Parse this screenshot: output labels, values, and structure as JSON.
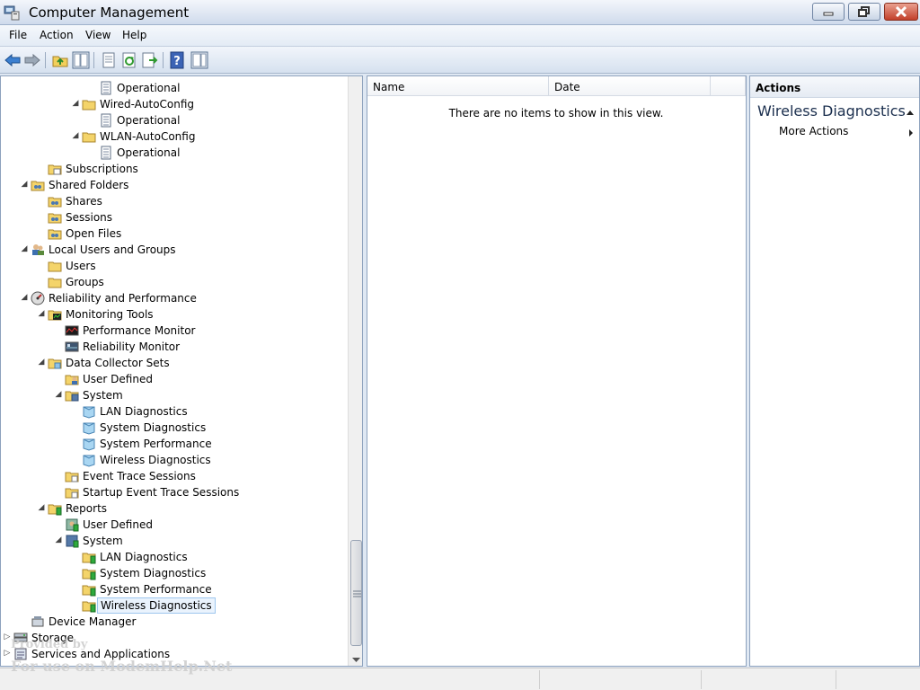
{
  "window": {
    "title": "Computer Management"
  },
  "menu": [
    "File",
    "Action",
    "View",
    "Help"
  ],
  "tree": [
    {
      "label": "Operational",
      "indent": 5,
      "icon": "log",
      "exp": ""
    },
    {
      "label": "Wired-AutoConfig",
      "indent": 4,
      "icon": "folder",
      "exp": "open"
    },
    {
      "label": "Operational",
      "indent": 5,
      "icon": "log",
      "exp": ""
    },
    {
      "label": "WLAN-AutoConfig",
      "indent": 4,
      "icon": "folder",
      "exp": "open"
    },
    {
      "label": "Operational",
      "indent": 5,
      "icon": "log",
      "exp": ""
    },
    {
      "label": "Subscriptions",
      "indent": 2,
      "icon": "subscriptions",
      "exp": ""
    },
    {
      "label": "Shared Folders",
      "indent": 1,
      "icon": "shared-folder",
      "exp": "open"
    },
    {
      "label": "Shares",
      "indent": 2,
      "icon": "shared-folder",
      "exp": ""
    },
    {
      "label": "Sessions",
      "indent": 2,
      "icon": "shared-folder",
      "exp": ""
    },
    {
      "label": "Open Files",
      "indent": 2,
      "icon": "shared-folder",
      "exp": ""
    },
    {
      "label": "Local Users and Groups",
      "indent": 1,
      "icon": "users",
      "exp": "open"
    },
    {
      "label": "Users",
      "indent": 2,
      "icon": "folder",
      "exp": ""
    },
    {
      "label": "Groups",
      "indent": 2,
      "icon": "folder",
      "exp": ""
    },
    {
      "label": "Reliability and Performance",
      "indent": 1,
      "icon": "gauge",
      "exp": "open"
    },
    {
      "label": "Monitoring Tools",
      "indent": 2,
      "icon": "monitor-folder",
      "exp": "open"
    },
    {
      "label": "Performance Monitor",
      "indent": 3,
      "icon": "perf-monitor",
      "exp": ""
    },
    {
      "label": "Reliability Monitor",
      "indent": 3,
      "icon": "rel-monitor",
      "exp": ""
    },
    {
      "label": "Data Collector Sets",
      "indent": 2,
      "icon": "dcs-folder",
      "exp": "open"
    },
    {
      "label": "User Defined",
      "indent": 3,
      "icon": "user-folder",
      "exp": ""
    },
    {
      "label": "System",
      "indent": 3,
      "icon": "system-folder",
      "exp": "open"
    },
    {
      "label": "LAN Diagnostics",
      "indent": 4,
      "icon": "collector",
      "exp": ""
    },
    {
      "label": "System Diagnostics",
      "indent": 4,
      "icon": "collector",
      "exp": ""
    },
    {
      "label": "System Performance",
      "indent": 4,
      "icon": "collector",
      "exp": ""
    },
    {
      "label": "Wireless Diagnostics",
      "indent": 4,
      "icon": "collector",
      "exp": ""
    },
    {
      "label": "Event Trace Sessions",
      "indent": 3,
      "icon": "trace-folder",
      "exp": ""
    },
    {
      "label": "Startup Event Trace Sessions",
      "indent": 3,
      "icon": "trace-folder",
      "exp": ""
    },
    {
      "label": "Reports",
      "indent": 2,
      "icon": "report-folder",
      "exp": "open"
    },
    {
      "label": "User Defined",
      "indent": 3,
      "icon": "report-user",
      "exp": ""
    },
    {
      "label": "System",
      "indent": 3,
      "icon": "report-system",
      "exp": "open"
    },
    {
      "label": "LAN Diagnostics",
      "indent": 4,
      "icon": "report-folder",
      "exp": ""
    },
    {
      "label": "System Diagnostics",
      "indent": 4,
      "icon": "report-folder",
      "exp": ""
    },
    {
      "label": "System Performance",
      "indent": 4,
      "icon": "report-folder",
      "exp": ""
    },
    {
      "label": "Wireless Diagnostics",
      "indent": 4,
      "icon": "report-folder",
      "exp": "",
      "selected": true
    },
    {
      "label": "Device Manager",
      "indent": 1,
      "icon": "device-manager",
      "exp": ""
    },
    {
      "label": "Storage",
      "indent": 0,
      "icon": "storage",
      "exp": "closed"
    },
    {
      "label": "Services and Applications",
      "indent": 0,
      "icon": "services",
      "exp": "closed"
    }
  ],
  "list": {
    "columns": [
      "Name",
      "Date"
    ],
    "empty_text": "There are no items to show in this view."
  },
  "actions": {
    "header": "Actions",
    "section": "Wireless Diagnostics",
    "items": [
      "More Actions"
    ]
  },
  "watermark": {
    "line1": "Provided by",
    "line2": "For use on ModemHelp.Net"
  },
  "colors": {
    "accent": "#1b2f4e",
    "selection": "#eaf3fd"
  }
}
